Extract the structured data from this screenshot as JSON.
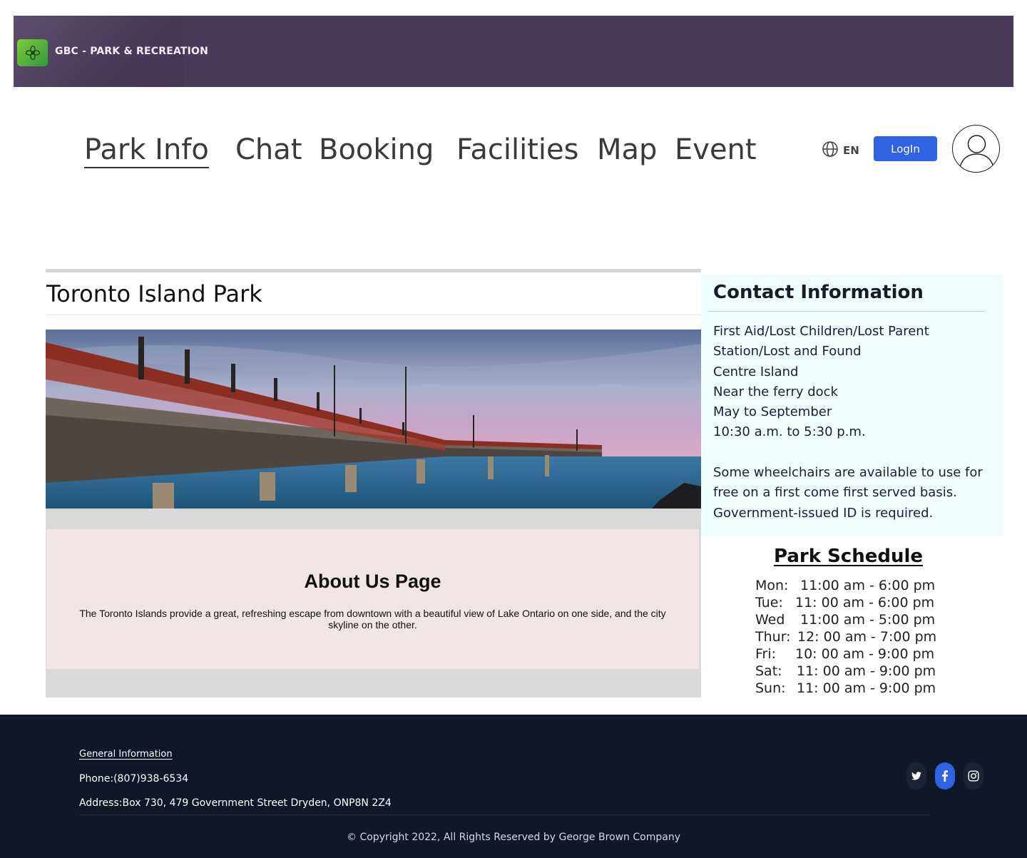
{
  "header": {
    "logo_text": "GBC - PARK & RECREATION"
  },
  "nav": {
    "items": [
      "Park Info",
      "Chat",
      "Booking",
      "Facilities",
      "Map",
      "Event"
    ],
    "active": "Park Info",
    "language": "EN",
    "login_label": "LogIn"
  },
  "main": {
    "park_title": "Toronto Island Park",
    "hero_image": "pier-over-lake-photo",
    "about": {
      "title": "About Us Page",
      "text": "The Toronto Islands provide a great, refreshing escape from downtown with a beautiful view of Lake Ontario on one side, and the city skyline on the other."
    }
  },
  "contact": {
    "title": "Contact Information",
    "lines": [
      "First Aid/Lost Children/Lost Parent",
      "Station/Lost and Found",
      "Centre Island",
      "Near the ferry dock",
      "May to September",
      "10:30 a.m. to 5:30 p.m."
    ],
    "note_lines": [
      "Some wheelchairs are available to use for",
      "free on a first come first served basis.",
      "Government-issued ID is required."
    ]
  },
  "schedule": {
    "title": "Park Schedule",
    "rows": [
      {
        "day": "Mon:",
        "hours": "11:00 am - 6:00 pm"
      },
      {
        "day": "Tue:",
        "hours": "11: 00 am - 6:00 pm"
      },
      {
        "day": "Wed",
        "hours": "11:00 am - 5:00 pm"
      },
      {
        "day": "Thur:",
        "hours": "12: 00 am - 7:00 pm"
      },
      {
        "day": "Fri:",
        "hours": "10: 00 am - 9:00 pm"
      },
      {
        "day": "Sat:",
        "hours": "11: 00 am - 9:00 pm"
      },
      {
        "day": "Sun:",
        "hours": "11: 00 am - 9:00 pm"
      }
    ]
  },
  "footer": {
    "general_info": "General Information",
    "phone": "Phone:(807)938-6534",
    "address": "Address:Box 730, 479 Government Street Dryden, ONP8N 2Z4",
    "copyright": "© Copyright 2022, All Rights Reserved by George Brown Company",
    "social": [
      "twitter-icon",
      "facebook-icon",
      "instagram-icon"
    ]
  },
  "colors": {
    "banner": "#4a3a5a",
    "login_button": "#2f63e4",
    "contact_bg": "#eefefe",
    "about_bg": "#f1e5e5",
    "footer_bg": "#101828"
  }
}
